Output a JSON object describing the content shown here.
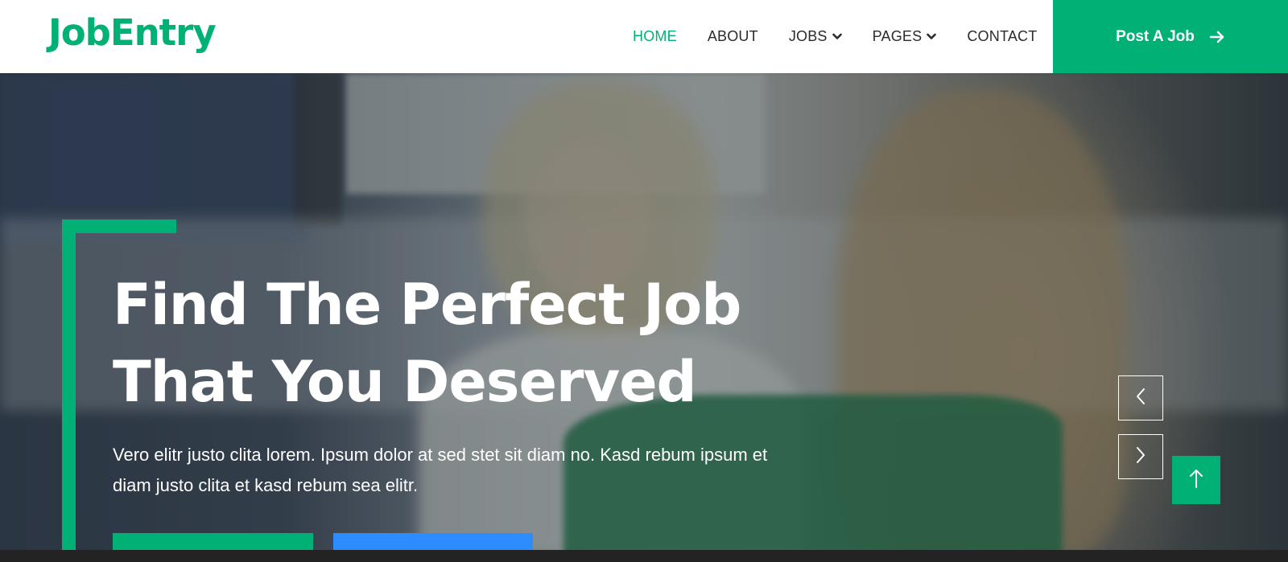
{
  "brand": {
    "name": "JobEntry"
  },
  "nav": {
    "items": [
      {
        "label": "HOME",
        "active": true,
        "dropdown": false
      },
      {
        "label": "ABOUT",
        "active": false,
        "dropdown": false
      },
      {
        "label": "JOBS",
        "active": false,
        "dropdown": true
      },
      {
        "label": "PAGES",
        "active": false,
        "dropdown": true
      },
      {
        "label": "CONTACT",
        "active": false,
        "dropdown": false
      }
    ],
    "cta_label": "Post A Job",
    "cta_icon": "arrow-right-icon"
  },
  "hero": {
    "title_line1": "Find The Perfect Job",
    "title_line2": "That You Deserved",
    "description": "Vero elitr justo clita lorem. Ipsum dolor at sed stet sit diam no. Kasd rebum ipsum et diam justo clita et kasd rebum sea elitr.",
    "prev_icon": "chevron-left-icon",
    "next_icon": "chevron-right-icon"
  },
  "back_to_top": {
    "icon": "arrow-up-icon"
  },
  "colors": {
    "accent": "#00B074",
    "secondary": "#2D8CFF",
    "nav_text": "#2b2b2b",
    "hero_text": "#ffffff"
  }
}
